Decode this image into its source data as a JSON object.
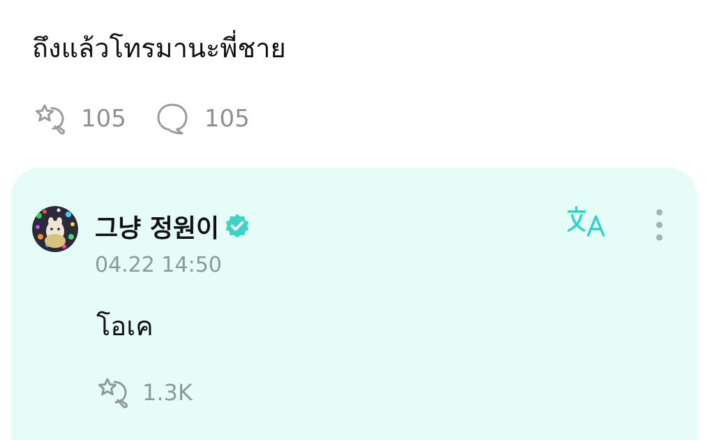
{
  "post": {
    "text": "ถึงแล้วโทรมานะพี่ชาย",
    "reaction_count": "105",
    "comment_count": "105"
  },
  "reply": {
    "author": "그냥 정원이",
    "verified": true,
    "timestamp": "04.22 14:50",
    "text": "โอเค",
    "reaction_count": "1.3K"
  },
  "icons": {
    "reaction": "star-reaction-icon",
    "comment": "speech-bubble-icon",
    "verified": "verified-badge-icon",
    "translate": "translate-icon",
    "more": "more-vertical-icon"
  },
  "colors": {
    "card_background": "#e6fcf7",
    "accent": "#2fd3c6",
    "muted_text": "#8f8f8f",
    "primary_text": "#111111"
  }
}
